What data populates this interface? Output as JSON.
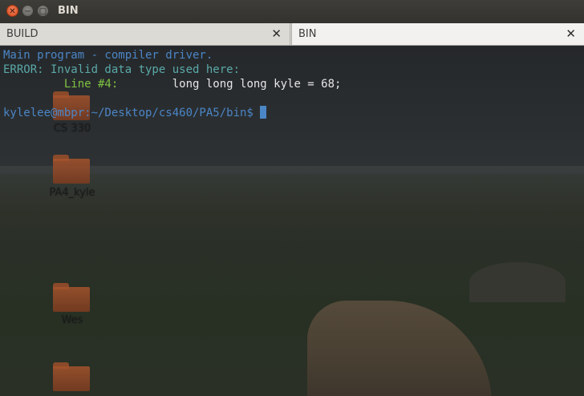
{
  "window": {
    "title": "BIN"
  },
  "tabs": [
    {
      "label": "BUILD"
    },
    {
      "label": "BIN"
    }
  ],
  "terminal": {
    "line1": "Main program - compiler driver.",
    "line2": "ERROR: Invalid data type used here:",
    "line3_label": "Line #4:",
    "line3_code": "long long long kyle = 68;",
    "prompt": "kylelee@mbpr:~/Desktop/cs460/PA5/bin$"
  },
  "desktop_icons": [
    {
      "label": "CS 330"
    },
    {
      "label": "PA4_kyle"
    },
    {
      "label": "Wes"
    }
  ]
}
